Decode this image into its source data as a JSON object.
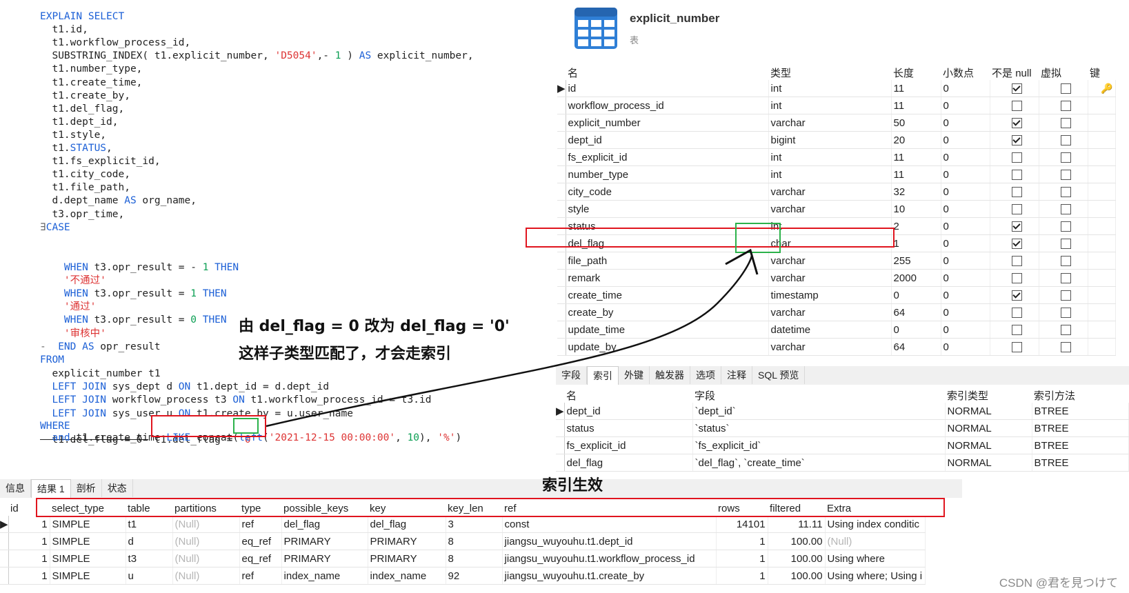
{
  "sql": {
    "lines": [
      [
        [
          "kw",
          "EXPLAIN SELECT"
        ]
      ],
      [
        [
          "id",
          "  t1.id,"
        ]
      ],
      [
        [
          "id",
          "  t1.workflow_process_id,"
        ]
      ],
      [
        [
          "id",
          "  SUBSTRING_INDEX( t1.explicit_number, "
        ],
        [
          "str",
          "'D5054'"
        ],
        [
          "id",
          ",- "
        ],
        [
          "num",
          "1"
        ],
        [
          "id",
          " ) "
        ],
        [
          "kw",
          "AS"
        ],
        [
          "id",
          " explicit_number,"
        ]
      ],
      [
        [
          "id",
          "  t1.number_type,"
        ]
      ],
      [
        [
          "id",
          "  t1.create_time,"
        ]
      ],
      [
        [
          "id",
          "  t1.create_by,"
        ]
      ],
      [
        [
          "id",
          "  t1.del_flag,"
        ]
      ],
      [
        [
          "id",
          "  t1.dept_id,"
        ]
      ],
      [
        [
          "id",
          "  t1.style,"
        ]
      ],
      [
        [
          "id",
          "  t1."
        ],
        [
          "kw",
          "STATUS"
        ],
        [
          "id",
          ","
        ]
      ],
      [
        [
          "id",
          "  t1.fs_explicit_id,"
        ]
      ],
      [
        [
          "id",
          "  t1.city_code,"
        ]
      ],
      [
        [
          "id",
          "  t1.file_path,"
        ]
      ],
      [
        [
          "id",
          "  d.dept_name "
        ],
        [
          "kw",
          "AS"
        ],
        [
          "id",
          " org_name,"
        ]
      ],
      [
        [
          "id",
          "  t3.opr_time,"
        ]
      ],
      [
        [
          "gut",
          "∃"
        ],
        [
          "kw",
          "CASE"
        ]
      ],
      [],
      [
        [
          "kw",
          "    WHEN"
        ],
        [
          "id",
          " t3.opr_result = - "
        ],
        [
          "num",
          "1"
        ],
        [
          "kw",
          " THEN"
        ]
      ],
      [
        [
          "str",
          "    '不通过'"
        ]
      ],
      [
        [
          "kw",
          "    WHEN"
        ],
        [
          "id",
          " t3.opr_result = "
        ],
        [
          "num",
          "1"
        ],
        [
          "kw",
          " THEN"
        ]
      ],
      [
        [
          "str",
          "    '通过'"
        ]
      ],
      [
        [
          "kw",
          "    WHEN"
        ],
        [
          "id",
          " t3.opr_result = "
        ],
        [
          "num",
          "0"
        ],
        [
          "kw",
          " THEN"
        ]
      ],
      [
        [
          "str",
          "    '审核中'"
        ]
      ],
      [
        [
          "gut",
          "- "
        ],
        [
          "kw",
          " END AS"
        ],
        [
          "id",
          " opr_result"
        ]
      ],
      [
        [
          "kw",
          "FROM"
        ]
      ],
      [
        [
          "id",
          "  explicit_number t1"
        ]
      ],
      [
        [
          "kw",
          "  LEFT JOIN"
        ],
        [
          "id",
          " sys_dept d "
        ],
        [
          "kw",
          "ON"
        ],
        [
          "id",
          " t1.dept_id = d.dept_id"
        ]
      ],
      [
        [
          "kw",
          "  LEFT JOIN"
        ],
        [
          "id",
          " workflow_process t3 "
        ],
        [
          "kw",
          "ON"
        ],
        [
          "id",
          " t1.workflow_process_id = t3.id"
        ]
      ],
      [
        [
          "kw",
          "  LEFT JOIN"
        ],
        [
          "id",
          " sys_user u "
        ],
        [
          "kw",
          "ON"
        ],
        [
          "id",
          " t1.create_by = u.user_name"
        ]
      ],
      [
        [
          "kw",
          "WHERE"
        ]
      ],
      [
        [
          "strike",
          "  t1.del_flag = 0 "
        ],
        [
          "id",
          " t1.del_flag = "
        ],
        [
          "str",
          "'0'"
        ]
      ],
      [
        [
          "kw",
          "  and"
        ],
        [
          "id",
          " t1.create_time "
        ],
        [
          "kw",
          "LIKE"
        ],
        [
          "id",
          " concat("
        ],
        [
          "kw",
          "left"
        ],
        [
          "id",
          "("
        ],
        [
          "str",
          "'2021-12-15 00:00:00'"
        ],
        [
          "id",
          ", "
        ],
        [
          "num",
          "10"
        ],
        [
          "id",
          "), "
        ],
        [
          "str",
          "'%'"
        ],
        [
          "id",
          ")"
        ]
      ]
    ]
  },
  "table_info": {
    "name": "explicit_number",
    "subtitle": "表",
    "icon": "table-icon"
  },
  "fields": {
    "headers": [
      "名",
      "类型",
      "长度",
      "小数点",
      "不是 null",
      "虚拟",
      "键"
    ],
    "rows": [
      {
        "name": "id",
        "type": "int",
        "length": "11",
        "decimals": "0",
        "not_null": true,
        "virtual": false,
        "key": true,
        "current": true
      },
      {
        "name": "workflow_process_id",
        "type": "int",
        "length": "11",
        "decimals": "0",
        "not_null": false,
        "virtual": false,
        "key": false
      },
      {
        "name": "explicit_number",
        "type": "varchar",
        "length": "50",
        "decimals": "0",
        "not_null": true,
        "virtual": false,
        "key": false
      },
      {
        "name": "dept_id",
        "type": "bigint",
        "length": "20",
        "decimals": "0",
        "not_null": true,
        "virtual": false,
        "key": false
      },
      {
        "name": "fs_explicit_id",
        "type": "int",
        "length": "11",
        "decimals": "0",
        "not_null": false,
        "virtual": false,
        "key": false
      },
      {
        "name": "number_type",
        "type": "int",
        "length": "11",
        "decimals": "0",
        "not_null": false,
        "virtual": false,
        "key": false
      },
      {
        "name": "city_code",
        "type": "varchar",
        "length": "32",
        "decimals": "0",
        "not_null": false,
        "virtual": false,
        "key": false
      },
      {
        "name": "style",
        "type": "varchar",
        "length": "10",
        "decimals": "0",
        "not_null": false,
        "virtual": false,
        "key": false
      },
      {
        "name": "status",
        "type": "int",
        "length": "2",
        "decimals": "0",
        "not_null": true,
        "virtual": false,
        "key": false
      },
      {
        "name": "del_flag",
        "type": "char",
        "length": "1",
        "decimals": "0",
        "not_null": true,
        "virtual": false,
        "key": false
      },
      {
        "name": "file_path",
        "type": "varchar",
        "length": "255",
        "decimals": "0",
        "not_null": false,
        "virtual": false,
        "key": false
      },
      {
        "name": "remark",
        "type": "varchar",
        "length": "2000",
        "decimals": "0",
        "not_null": false,
        "virtual": false,
        "key": false
      },
      {
        "name": "create_time",
        "type": "timestamp",
        "length": "0",
        "decimals": "0",
        "not_null": true,
        "virtual": false,
        "key": false
      },
      {
        "name": "create_by",
        "type": "varchar",
        "length": "64",
        "decimals": "0",
        "not_null": false,
        "virtual": false,
        "key": false
      },
      {
        "name": "update_time",
        "type": "datetime",
        "length": "0",
        "decimals": "0",
        "not_null": false,
        "virtual": false,
        "key": false
      },
      {
        "name": "update_by",
        "type": "varchar",
        "length": "64",
        "decimals": "0",
        "not_null": false,
        "virtual": false,
        "key": false
      }
    ]
  },
  "design_tabs": [
    "字段",
    "索引",
    "外键",
    "触发器",
    "选项",
    "注释",
    "SQL 预览"
  ],
  "indexes": {
    "headers": [
      "名",
      "字段",
      "索引类型",
      "索引方法"
    ],
    "rows": [
      {
        "name": "dept_id",
        "field": "`dept_id`",
        "type": "NORMAL",
        "method": "BTREE"
      },
      {
        "name": "status",
        "field": "`status`",
        "type": "NORMAL",
        "method": "BTREE"
      },
      {
        "name": "fs_explicit_id",
        "field": "`fs_explicit_id`",
        "type": "NORMAL",
        "method": "BTREE"
      },
      {
        "name": "del_flag",
        "field": "`del_flag`, `create_time`",
        "type": "NORMAL",
        "method": "BTREE"
      }
    ]
  },
  "result_tabs": [
    "信息",
    "结果 1",
    "剖析",
    "状态"
  ],
  "results": {
    "headers": [
      "id",
      "select_type",
      "table",
      "partitions",
      "type",
      "possible_keys",
      "key",
      "key_len",
      "ref",
      "rows",
      "filtered",
      "Extra"
    ],
    "rows": [
      [
        "1",
        "SIMPLE",
        "t1",
        "(Null)",
        "ref",
        "del_flag",
        "del_flag",
        "3",
        "const",
        "14101",
        "11.11",
        "Using index conditic"
      ],
      [
        "1",
        "SIMPLE",
        "d",
        "(Null)",
        "eq_ref",
        "PRIMARY",
        "PRIMARY",
        "8",
        "jiangsu_wuyouhu.t1.dept_id",
        "1",
        "100.00",
        "(Null)"
      ],
      [
        "1",
        "SIMPLE",
        "t3",
        "(Null)",
        "eq_ref",
        "PRIMARY",
        "PRIMARY",
        "8",
        "jiangsu_wuyouhu.t1.workflow_process_id",
        "1",
        "100.00",
        "Using where"
      ],
      [
        "1",
        "SIMPLE",
        "u",
        "(Null)",
        "ref",
        "index_name",
        "index_name",
        "92",
        "jiangsu_wuyouhu.t1.create_by",
        "1",
        "100.00",
        "Using where; Using i"
      ]
    ]
  },
  "annotations": {
    "line1": "由  del_flag = 0  改为 del_flag = '0'",
    "line2": "这样子类型匹配了，才会走索引",
    "index_effective": "索引生效"
  },
  "watermark": "CSDN @君を見つけて",
  "colors": {
    "keyword": "#1b5fd6",
    "string": "#d33",
    "number": "#0a9e52",
    "highlight_red": "#e0141e",
    "highlight_green": "#2bb24a"
  }
}
